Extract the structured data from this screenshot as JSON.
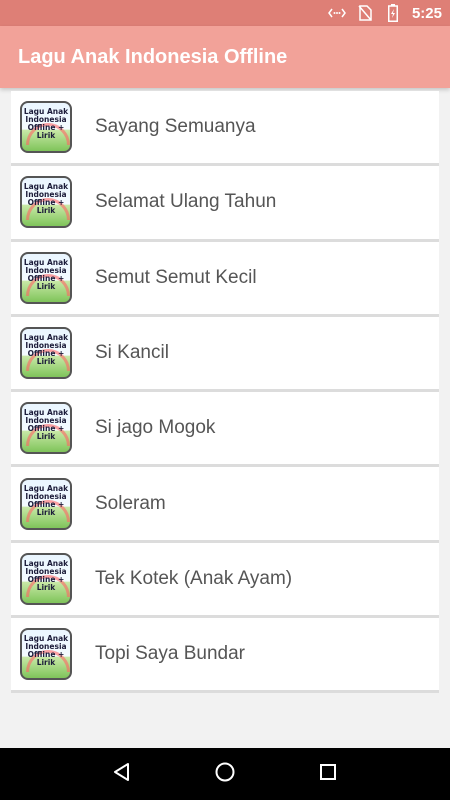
{
  "status_bar": {
    "time": "5:25",
    "icons": [
      "data-sync-icon",
      "no-sim-icon",
      "battery-charging-icon"
    ]
  },
  "app_bar": {
    "title": "Lagu Anak Indonesia Offline"
  },
  "thumbnail": {
    "line1": "Lagu Anak",
    "line2": "Indonesia",
    "line3": "Offline + Lirik"
  },
  "songs": [
    {
      "label": "Sayang Semuanya"
    },
    {
      "label": "Selamat Ulang Tahun"
    },
    {
      "label": "Semut Semut Kecil"
    },
    {
      "label": "Si Kancil"
    },
    {
      "label": "Si jago Mogok"
    },
    {
      "label": "Soleram"
    },
    {
      "label": "Tek Kotek (Anak Ayam)"
    },
    {
      "label": "Topi Saya Bundar"
    }
  ],
  "nav_bar": {
    "icons": [
      "back-icon",
      "home-icon",
      "recents-icon"
    ]
  },
  "colors": {
    "status_bar": "#de7f76",
    "app_bar": "#f2a299",
    "background": "#f2f2f2"
  }
}
